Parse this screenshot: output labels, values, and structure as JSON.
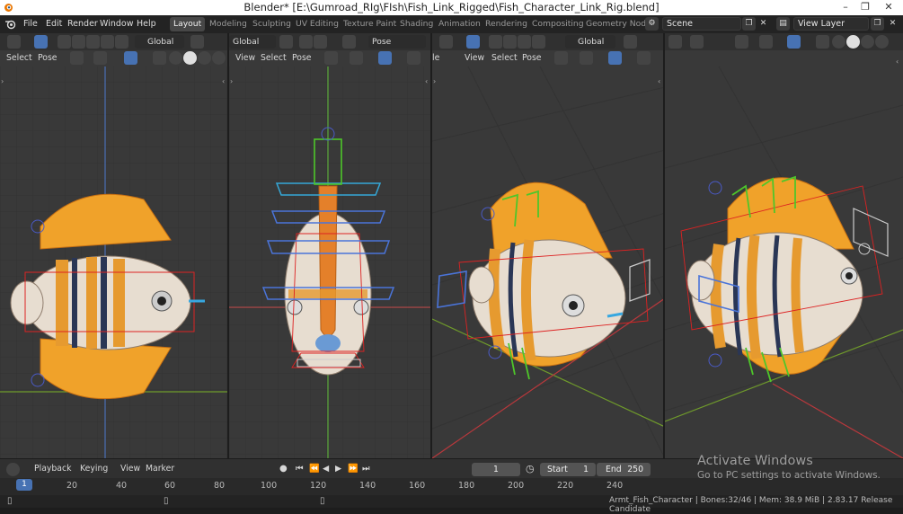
{
  "titlebar": {
    "title": "Blender* [E:\\Gumroad_RIg\\FIsh\\Fish_Link_Rigged\\Fish_Character_Link_Rig.blend]"
  },
  "menu": [
    "File",
    "Edit",
    "Render",
    "Window",
    "Help"
  ],
  "workspaces": [
    "Layout",
    "Modeling",
    "Sculpting",
    "UV Editing",
    "Texture Paint",
    "Shading",
    "Animation",
    "Rendering",
    "Compositing",
    "Geometry Nod"
  ],
  "scene": {
    "value": "Scene"
  },
  "view_layer": {
    "value": "View Layer"
  },
  "viewport1": {
    "select": "Select",
    "pose": "Pose",
    "orientation": "Global"
  },
  "viewport2": {
    "view": "View",
    "select": "Select",
    "pose": "Pose",
    "orientation": "Global",
    "pose_options": "Pose Options"
  },
  "viewport3": {
    "view": "View",
    "select": "Select",
    "pose": "Pose",
    "orientation": "Global",
    "cut": "le"
  },
  "timeline": {
    "playback": "Playback",
    "keying": "Keying",
    "view": "View",
    "marker": "Marker",
    "current_frame": "1",
    "start_label": "Start",
    "start": "1",
    "end_label": "End",
    "end": "250",
    "frames": [
      "20",
      "40",
      "60",
      "80",
      "100",
      "120",
      "140",
      "160",
      "180",
      "200",
      "220",
      "240"
    ],
    "current_marker": "1"
  },
  "status": {
    "text": "Armt_Fish_Character | Bones:32/46 | Mem: 38.9 MiB | 2.83.17 Release Candidate"
  },
  "watermark": {
    "title": "Activate Windows",
    "subtitle": "Go to PC settings to activate Windows."
  },
  "colors": {
    "accent": "#4772b3",
    "viewport_bg": "#393939",
    "header_bg": "#303030",
    "bone_green": "#4ec62a",
    "bone_blue": "#4a74d9",
    "bone_cyan": "#35a8d8",
    "bone_red": "#cc2b2b"
  }
}
